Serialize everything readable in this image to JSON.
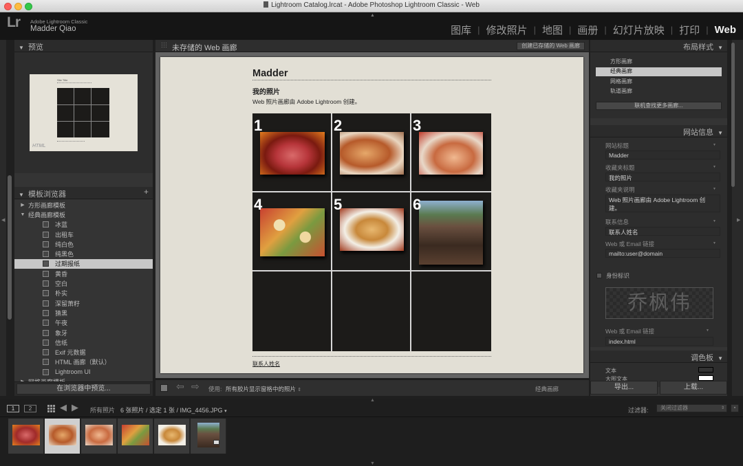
{
  "window": {
    "title": "Lightroom Catalog.lrcat - Adobe Photoshop Lightroom Classic - Web"
  },
  "identity": {
    "logo": "Lr",
    "app_name": "Adobe Lightroom Classic",
    "user": "Madder Qiao"
  },
  "modules": [
    "图库",
    "修改照片",
    "地图",
    "画册",
    "幻灯片放映",
    "打印",
    "Web"
  ],
  "left": {
    "preview_title": "预览",
    "preview_site_title": "Site Title",
    "preview_html_badge": "HTML",
    "templates_title": "模板浏览器",
    "folders": {
      "square": "方形画廊模板",
      "classic": "经典画廊模板",
      "grid": "网格画廊模板"
    },
    "classic_items": [
      "冰蓝",
      "出租车",
      "纯白色",
      "纯黑色",
      "过期报纸",
      "黄昏",
      "空白",
      "朴实",
      "深留萧籽",
      "猜黑",
      "午夜",
      "象牙",
      "信纸",
      "Exif 元数据",
      "HTML 画廊（默认）",
      "Lightroom UI"
    ],
    "preview_in_browser": "在浏览器中预览..."
  },
  "center": {
    "header_title": "未存储的 Web 画廊",
    "save_button": "创建已存储的 Web 画廊",
    "site_title": "Madder",
    "collection_title": "我的照片",
    "collection_desc": "Web 照片画廊由 Adobe Lightroom 创建。",
    "numbers": [
      "1",
      "2",
      "3",
      "4",
      "5",
      "6"
    ],
    "contact": "联系人姓名",
    "toolbar_use_label": "使用:",
    "toolbar_use_value": "所有胶片显示窗格中的照片",
    "toolbar_style": "经典画廊"
  },
  "right": {
    "layout_title": "布局样式",
    "layout_items": [
      "方形画廊",
      "经典画廊",
      "网格画廊",
      "轨道画廊"
    ],
    "find_more": "联机查找更多画廊...",
    "site_info_title": "网站信息",
    "fields": [
      {
        "label": "网站标题",
        "value": "Madder"
      },
      {
        "label": "收藏夹标题",
        "value": "我的照片"
      },
      {
        "label": "收藏夹说明",
        "value": "Web 照片画廊由 Adobe Lightroom 创建。"
      },
      {
        "label": "联系信息",
        "value": "联系人姓名"
      },
      {
        "label": "Web 或 Email 链接",
        "value": "mailto:user@domain"
      }
    ],
    "identity_label": "身份标识",
    "identity_text": "乔枫伟",
    "link2_label": "Web 或 Email 链接",
    "link2_value": "index.html",
    "palette_title": "调色板",
    "palette_text": "文本",
    "palette_detail": "大图文本",
    "export": "导出...",
    "upload": "上载..."
  },
  "filmstrip": {
    "page1": "1",
    "page2": "2",
    "source": "所有照片",
    "count": "6 张照片 / 选定 1 张 / IMG_4456.JPG",
    "filter_label": "过滤器:",
    "filter_value": "关闭过滤器"
  },
  "colors": {
    "panel": "#343434",
    "page_bg": "#e2dfd5",
    "grid_bg": "#1c1b19",
    "selected": "#c7c7c7"
  }
}
